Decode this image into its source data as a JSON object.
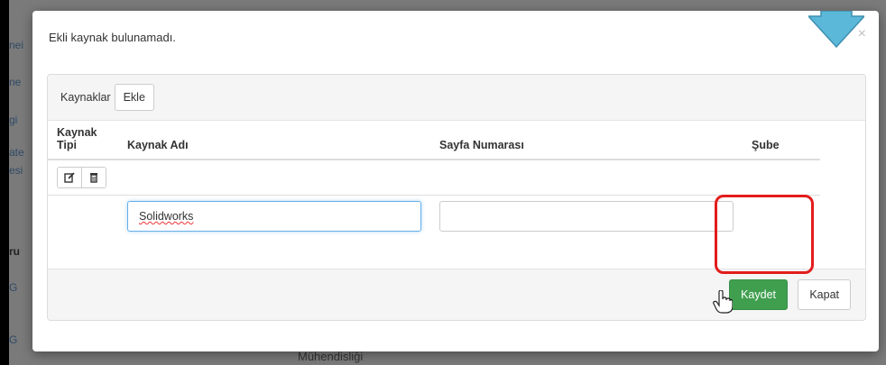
{
  "background": {
    "fragments": [
      "nei",
      "ne",
      "gi",
      "ate",
      "esi",
      "ru",
      "G",
      "G"
    ],
    "footer_text": "Mühendisliği"
  },
  "modal": {
    "title": "Ekli kaynak bulunamadı.",
    "close_symbol": "×",
    "panel": {
      "resources_label": "Kaynaklar",
      "add_button": "Ekle",
      "columns": [
        "Kaynak Tipi",
        "Kaynak Adı",
        "Sayfa Numarası",
        "Şube"
      ],
      "row": {
        "name_value": "Solidworks",
        "page_value": ""
      }
    },
    "footer": {
      "save_button": "Kaydet",
      "close_button": "Kapat"
    }
  },
  "icons": {
    "edit": "edit-icon",
    "delete": "trash-icon",
    "close": "close-icon",
    "cursor": "hand-pointer-icon",
    "arrow": "arrow-down-icon"
  },
  "colors": {
    "save_button": "#3f9f4f",
    "highlight": "#e31c1c",
    "arrow": "#5bb8d8"
  }
}
